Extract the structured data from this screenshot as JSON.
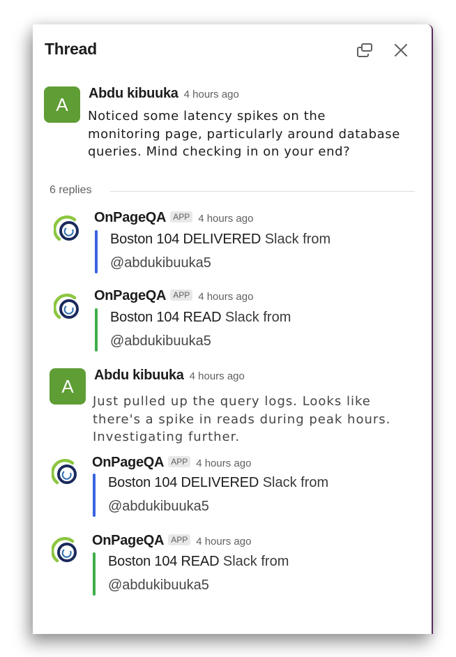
{
  "header": {
    "title": "Thread",
    "popout_icon": "popout-window-icon",
    "close_icon": "close-icon"
  },
  "parent": {
    "author": "Abdu kibuuka",
    "avatar_letter": "A",
    "time": "4 hours ago",
    "text_lines": [
      "Noticed some latency spikes on the",
      "monitoring page, particularly around database",
      "queries. Mind checking in on your end?"
    ]
  },
  "replies_label": "6 replies",
  "replies": [
    {
      "type": "app",
      "author": "OnPageQA",
      "badge": "APP",
      "time": "4 hours ago",
      "bold": "Boston 104 DELIVERED",
      "rest": "Slack from",
      "mention": "@abdukibuuka5",
      "bar_color": "#3b63e0"
    },
    {
      "type": "app",
      "author": "OnPageQA",
      "badge": "APP",
      "time": "4 hours ago",
      "bold": "Boston 104 READ",
      "rest": "Slack from",
      "mention": "@abdukibuuka5",
      "bar_color": "#3fae49"
    },
    {
      "type": "user",
      "author": "Abdu kibuuka",
      "avatar_letter": "A",
      "time": "4 hours ago",
      "text_lines": [
        "Just pulled up the query logs. Looks like",
        "there's a spike in reads during peak hours.",
        "Investigating further."
      ]
    },
    {
      "type": "app",
      "author": "OnPageQA",
      "badge": "APP",
      "time": "4 hours ago",
      "bold": "Boston 104 DELIVERED",
      "rest": "Slack from",
      "mention": "@abdukibuuka5",
      "bar_color": "#3b63e0"
    },
    {
      "type": "app",
      "author": "OnPageQA",
      "badge": "APP",
      "time": "4 hours ago",
      "bold": "Boston 104 READ",
      "rest": "Slack from",
      "mention": "@abdukibuuka5",
      "bar_color": "#3fae49"
    }
  ],
  "colors": {
    "avatar_green": "#5f9d35",
    "panel_edge": "#5b2a5d",
    "logo_green": "#8cc63f",
    "logo_navy": "#1b2a5c"
  }
}
